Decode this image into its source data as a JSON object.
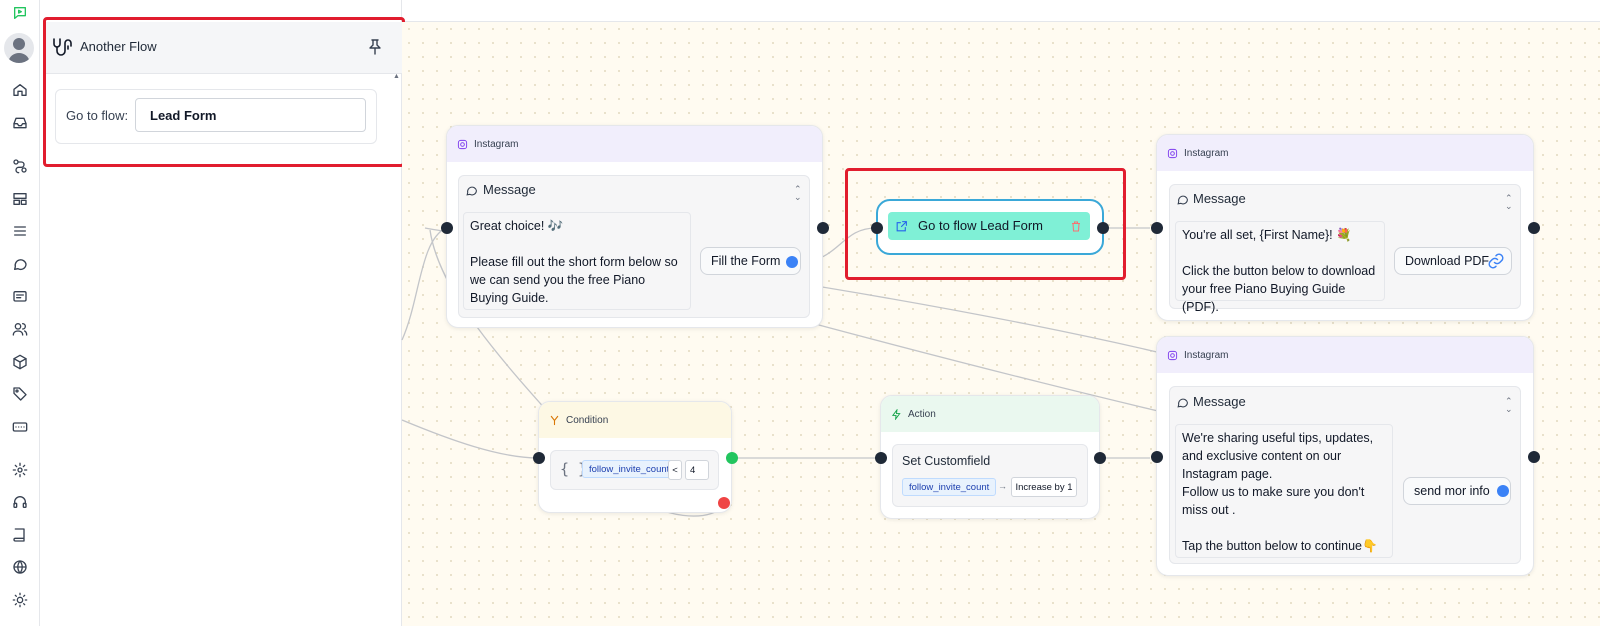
{
  "side_panel": {
    "title": "Another Flow",
    "goto_label": "Go to flow:",
    "goto_value": "Lead Form"
  },
  "nodes": {
    "instagram_1": {
      "channel": "Instagram",
      "message_title": "Message",
      "text": "Great choice! 🎶\n\nPlease fill out the short form below so we can send you the free Piano Buying Guide.",
      "button": "Fill the Form"
    },
    "goto_flow": {
      "label": "Go to flow Lead Form"
    },
    "instagram_2": {
      "channel": "Instagram",
      "message_title": "Message",
      "text": "You're all set, {First Name}! 💐\n\nClick the button below to download your free Piano Buying Guide (PDF).",
      "button": "Download PDF"
    },
    "instagram_3": {
      "channel": "Instagram",
      "message_title": "Message",
      "text": "We're sharing useful tips, updates, and exclusive content on our Instagram page.\nFollow us to make sure you don't miss out .\n\nTap the button below to continue👇",
      "button": "send mor info"
    },
    "condition": {
      "title": "Condition",
      "field": "follow_invite_count",
      "operator": "<",
      "value": "4"
    },
    "action": {
      "title": "Action",
      "subtitle": "Set Customfield",
      "field": "follow_invite_count",
      "arrow": "→",
      "operation": "Increase by 1"
    }
  },
  "colors": {
    "highlight": "#e11d2e",
    "goto_fill": "#7ff0d6",
    "goto_border": "#3aa8d8",
    "instagram_header": "#f1eefc",
    "condition_header": "#fdf8e4",
    "action_header": "#eaf8ef"
  },
  "icons": [
    "app-logo-icon",
    "home-icon",
    "inbox-icon",
    "flows-icon",
    "templates-icon",
    "list-icon",
    "chat-icon",
    "messages-icon",
    "contacts-icon",
    "package-icon",
    "tag-icon",
    "keyboard-icon",
    "settings-icon",
    "headset-icon",
    "book-icon",
    "globe-icon",
    "sun-icon"
  ]
}
